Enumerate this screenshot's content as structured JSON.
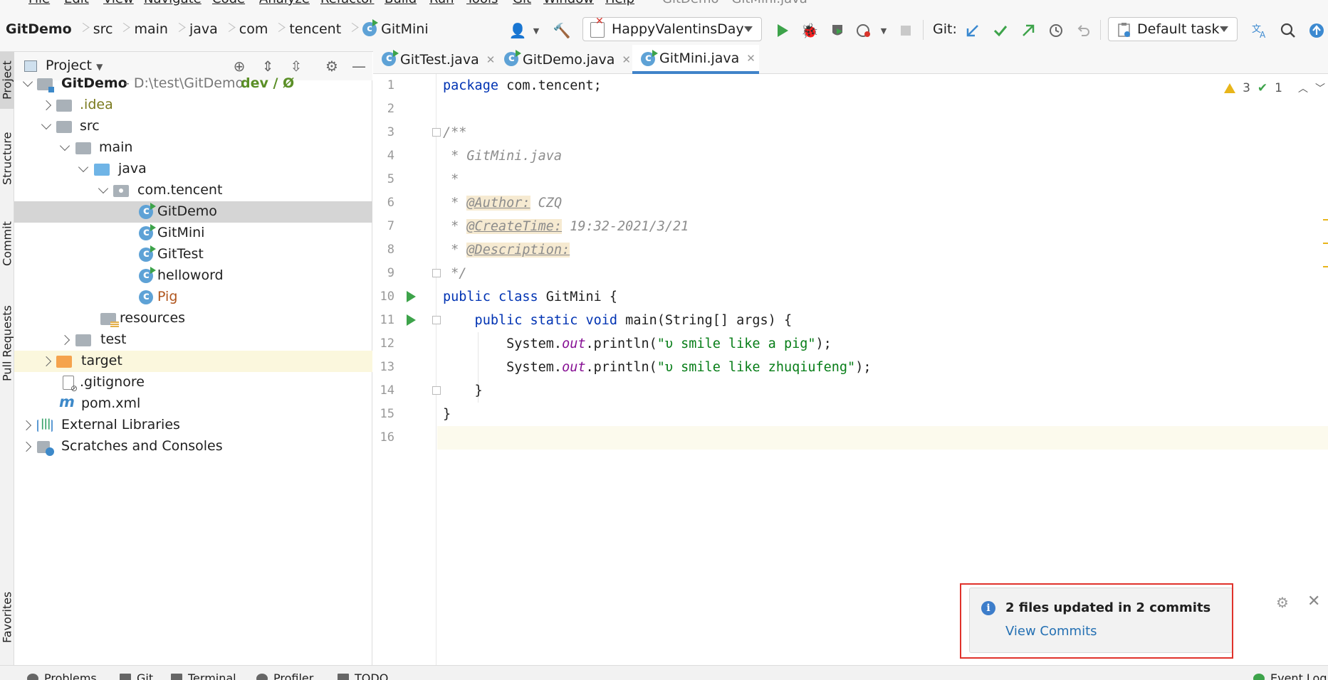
{
  "menu": {
    "items": [
      "File",
      "Edit",
      "View",
      "Navigate",
      "Code",
      "Analyze",
      "Refactor",
      "Build",
      "Run",
      "Tools",
      "Git",
      "Window",
      "Help"
    ],
    "window_title": "GitDemo - GitMini.java"
  },
  "breadcrumbs": [
    "GitDemo",
    "src",
    "main",
    "java",
    "com",
    "tencent",
    "GitMini"
  ],
  "toolbar": {
    "run_config": "HappyValentinsDay",
    "git_label": "Git:",
    "task": "Default task"
  },
  "left_strip": [
    "Project",
    "Structure",
    "Commit",
    "Pull Requests",
    "Favorites"
  ],
  "project_panel": {
    "title": "Project",
    "root_name": "GitDemo",
    "root_path": " - D:\\test\\GitDemo",
    "root_branch": "dev / Ø",
    "tree": [
      {
        "label": "GitDemo",
        "level": 0
      },
      {
        "label": ".idea",
        "level": 1
      },
      {
        "label": "src",
        "level": 1
      },
      {
        "label": "main",
        "level": 2
      },
      {
        "label": "java",
        "level": 3
      },
      {
        "label": "com.tencent",
        "level": 4
      },
      {
        "label": "GitDemo",
        "level": 5,
        "selected": true
      },
      {
        "label": "GitMini",
        "level": 5
      },
      {
        "label": "GitTest",
        "level": 5
      },
      {
        "label": "helloword",
        "level": 5
      },
      {
        "label": "Pig",
        "level": 5
      },
      {
        "label": "resources",
        "level": 4
      },
      {
        "label": "test",
        "level": 2
      },
      {
        "label": "target",
        "level": 1
      },
      {
        "label": ".gitignore",
        "level": 1
      },
      {
        "label": "pom.xml",
        "level": 1
      },
      {
        "label": "External Libraries",
        "level": 0
      },
      {
        "label": "Scratches and Consoles",
        "level": 0
      }
    ]
  },
  "tabs": [
    {
      "label": "GitTest.java",
      "active": false
    },
    {
      "label": "GitDemo.java",
      "active": false
    },
    {
      "label": "GitMini.java",
      "active": true
    }
  ],
  "editor": {
    "line_numbers": [
      "1",
      "2",
      "3",
      "4",
      "5",
      "6",
      "7",
      "8",
      "9",
      "10",
      "11",
      "12",
      "13",
      "14",
      "15",
      "16"
    ],
    "inspections": {
      "warnings": "3",
      "ok": "1"
    },
    "code": {
      "l1_kw": "package",
      "l1_rest": " com.tencent;",
      "l3": "/**",
      "l4": " * GitMini.java",
      "l5": " *",
      "l6_pre": " * ",
      "l6_tag": "@Author:",
      "l6_val": " CZQ",
      "l7_pre": " * ",
      "l7_tag": "@CreateTime:",
      "l7_val": " 19:32-2021/3/21",
      "l8_pre": " * ",
      "l8_tag": "@Description:",
      "l9": " */",
      "l10_kw": "public class",
      "l10_rest": " GitMini {",
      "l11_kw": "    public static void",
      "l11_rest": " main(String[] args) {",
      "l12_pre": "        System.",
      "l12_fld": "out",
      "l12_mid": ".println(",
      "l12_str": "\"υ smile like a pig\"",
      "l12_end": ");",
      "l13_pre": "        System.",
      "l13_fld": "out",
      "l13_mid": ".println(",
      "l13_str": "\"υ smile like zhuqiufeng\"",
      "l13_end": ");",
      "l14": "    }",
      "l15": "}"
    }
  },
  "notification": {
    "title": "2 files updated in 2 commits",
    "link": "View Commits"
  },
  "bottom_bar": [
    "Problems",
    "Git",
    "Terminal",
    "Profiler",
    "TODO",
    "Event Log"
  ],
  "colors": {
    "accent": "#4083c9",
    "keyword": "#0033b3",
    "string": "#067d17",
    "comment": "#8c8c8c",
    "highlight_box": "#e0322b"
  }
}
